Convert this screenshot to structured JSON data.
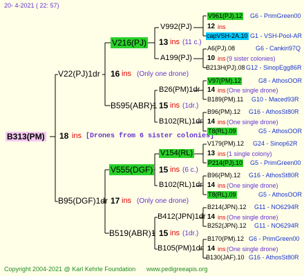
{
  "header": {
    "date": "20-   4-2021 (  22: 57)"
  },
  "root": {
    "name": "B313(PM)",
    "count": "18",
    "ins": "ins",
    "note": "[Drones from 6 sister colonies]"
  },
  "gen1": [
    {
      "name": "V22(PJ)1dr",
      "count": "16",
      "ins": "ins",
      "note": "(Only one drone)"
    },
    {
      "name": "B95(DGF)1dr",
      "count": "17",
      "ins": "ins",
      "note": "(Only one drone)"
    }
  ],
  "gen2": [
    {
      "name": "V216(PJ)",
      "count": "13",
      "ins": "ins",
      "note": "(11 c.)"
    },
    {
      "name": "B595(ABR)1",
      "count": "15",
      "ins": "ins",
      "note": "(1dr.)"
    },
    {
      "name": "V555(DGF)",
      "count": "15",
      "ins": "ins",
      "note": "(6 c.)"
    },
    {
      "name": "B519(ABR)1",
      "count": "15",
      "ins": "ins",
      "note": "(1dr.)"
    }
  ],
  "gen3": [
    {
      "name": "V992(PJ)",
      "count": "12",
      "ins": "ins",
      "note": ""
    },
    {
      "name": "A199(PJ)",
      "count": "10",
      "ins": "ins",
      "note": "(9 sister colonies)"
    },
    {
      "name": "B26(PM)1dr",
      "count": "14",
      "ins": "ins",
      "note": "(One single drone)"
    },
    {
      "name": "B102(RL)1dr",
      "count": "14",
      "ins": "ins",
      "note": "(One single drone)"
    },
    {
      "name": "V154(RL)",
      "count": "13",
      "ins": "ins",
      "note": "(1 single colony)"
    },
    {
      "name": "B102(RL)1dr",
      "count": "14",
      "ins": "ins",
      "note": "(One single drone)"
    },
    {
      "name": "B412(JPN)1dr",
      "count": "14",
      "ins": "ins",
      "note": "(One single drone)"
    },
    {
      "name": "B105(PM)1dr",
      "count": "14",
      "ins": "ins",
      "note": "(One single drone)"
    }
  ],
  "gen4": [
    {
      "name": "V961(PJ).12",
      "info": "G6 - PrimGreen00"
    },
    {
      "name": "capVSH-2A.10",
      "info": "G1 - VSH-Pool-AR"
    },
    {
      "name": "A6(PJ).08",
      "info": "G6 - Cankiri97Q"
    },
    {
      "name": "B213H(PJ).08",
      "info": "G12 - SinopEgg86R"
    },
    {
      "name": "V97(PM).12",
      "info": "G8 - AthosOOR"
    },
    {
      "name": "B189(PM).11",
      "info": "G10 - Maced93R"
    },
    {
      "name": "B96(PM).12",
      "info": "G16 - AthosSt80R"
    },
    {
      "name": "T8(RL).09",
      "info": "G5 - AthosOOR"
    },
    {
      "name": "V179(PM).12",
      "info": "G24 - Sinop62R"
    },
    {
      "name": "P214(PJ).10",
      "info": "G5 - PrimGreen00"
    },
    {
      "name": "B96(PM).12",
      "info": "G16 - AthosSt80R"
    },
    {
      "name": "T8(RL).09",
      "info": "G5 - AthosOOR"
    },
    {
      "name": "B214(JPN).12",
      "info": "G11 - NO6294R"
    },
    {
      "name": "B252(JPN).12",
      "info": "G11 - NO6294R"
    },
    {
      "name": "B170(PM).12",
      "info": "G6 - PrimGreen00"
    },
    {
      "name": "B130(JAF).10",
      "info": "G16 - AthosSt80R"
    }
  ],
  "footer": {
    "copyright": "Copyright 2004-2021 @ Karl Kehrle Foundation",
    "url": "www.pedigreeapis.org"
  }
}
